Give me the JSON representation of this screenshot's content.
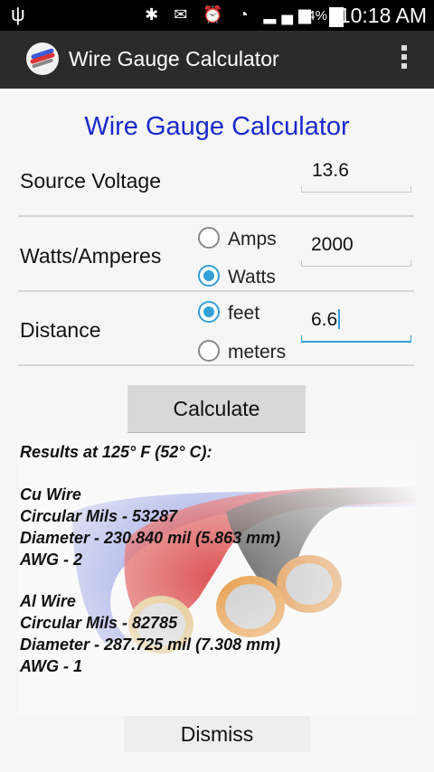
{
  "status_bar": {
    "battery": "94%",
    "time": "10:18 AM"
  },
  "action_bar": {
    "title": "Wire Gauge Calculator"
  },
  "main": {
    "heading": "Wire Gauge Calculator",
    "source_voltage": {
      "label": "Source Voltage",
      "value": "13.6"
    },
    "watts_amperes": {
      "label": "Watts/Amperes",
      "value": "2000",
      "options": [
        {
          "label": "Amps",
          "checked": false
        },
        {
          "label": "Watts",
          "checked": true
        }
      ]
    },
    "distance": {
      "label": "Distance",
      "value": "6.6",
      "options": [
        {
          "label": "feet",
          "checked": true
        },
        {
          "label": "meters",
          "checked": false
        }
      ]
    },
    "calculate_label": "Calculate",
    "results": {
      "header": "Results at 125° F (52° C):",
      "cu_title": "Cu Wire",
      "cu_circular_mils": "Circular Mils - 53287",
      "cu_diameter": "Diameter - 230.840 mil (5.863 mm)",
      "cu_awg": "AWG - 2",
      "al_title": "Al Wire",
      "al_circular_mils": "Circular Mils - 82785",
      "al_diameter": "Diameter - 287.725 mil (7.308 mm)",
      "al_awg": "AWG - 1"
    },
    "dismiss_label": "Dismiss"
  },
  "colors": {
    "heading": "#1a2acb",
    "accent": "#33a0d8",
    "action_bar": "#2b2b2b"
  }
}
